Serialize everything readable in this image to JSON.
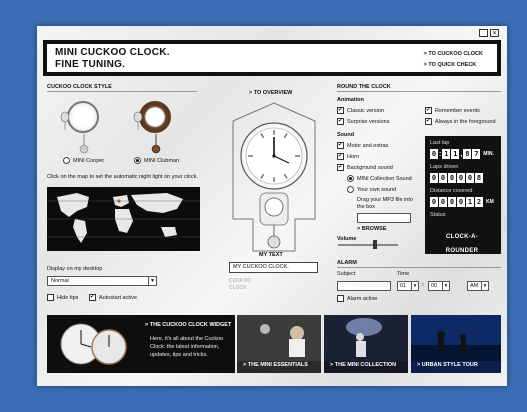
{
  "window": {
    "minimize_icon": "minimize-icon",
    "close_icon": "close-icon",
    "minimize_glyph": "_",
    "close_glyph": "×"
  },
  "banner": {
    "title_line1": "MINI CUCKOO CLOCK.",
    "title_line2": "FINE TUNING.",
    "link_clock": "> TO CUCKOO CLOCK",
    "link_quick_check": "> TO QUICK CHECK"
  },
  "style": {
    "heading": "CUCKOO CLOCK STYLE",
    "options": [
      {
        "label": "MINI Cooper",
        "selected": false
      },
      {
        "label": "MINI Clubman",
        "selected": true
      }
    ],
    "map_hint": "Click on the map to set the automatic night light on your clock.",
    "display_label": "Display on my desktop",
    "display_value": "Normal",
    "hide_tips": {
      "label": "Hide tips",
      "checked": false
    },
    "autostart": {
      "label": "Autostart active",
      "checked": true
    }
  },
  "overview": {
    "link": "> TO OVERVIEW",
    "mytext_label": "MY TEXT",
    "mytext_value": "MY CUCKOO CLOCK.",
    "mytext_preview": [
      "CUCKOO",
      "CLOCK"
    ]
  },
  "round": {
    "heading": "ROUND THE CLOCK",
    "animation_heading": "Animation",
    "animation": [
      {
        "label": "Classic version",
        "checked": true
      },
      {
        "label": "Surprise versions",
        "checked": true
      }
    ],
    "extra": [
      {
        "label": "Remember events",
        "checked": true
      },
      {
        "label": "Always in the foreground",
        "checked": true
      }
    ],
    "sound_heading": "Sound",
    "sound": [
      {
        "label": "Motor and extras",
        "checked": true
      },
      {
        "label": "Horn",
        "checked": true
      },
      {
        "label": "Background sound",
        "checked": true
      }
    ],
    "sound_choice": [
      {
        "label": "MINI Collection Sound",
        "selected": true
      },
      {
        "label": "Your own sound",
        "selected": false
      }
    ],
    "drag_hint": "Drag your MP3 file into the box",
    "browse": "> BROWSE",
    "volume_heading": "Volume",
    "volume_level": 0.58
  },
  "stats": {
    "last_lap": "Last lap",
    "last_lap_digits": [
      "0",
      "1",
      "1",
      "8",
      "7"
    ],
    "last_lap_unit": "MIN.",
    "laps_driven": "Laps driven",
    "laps_digits": [
      "0",
      "0",
      "0",
      "0",
      "0",
      "8"
    ],
    "distance": "Distance covered",
    "distance_digits": [
      "0",
      "0",
      "0",
      "0",
      "1",
      "2"
    ],
    "distance_unit": "KM",
    "status": "Status",
    "status_value": "CLOCK-A-ROUNDER"
  },
  "alarm": {
    "heading": "ALARM",
    "subject_label": "Subject",
    "subject_value": "",
    "time_label": "Time",
    "hour": "01",
    "minute": "00",
    "ampm": "AM",
    "active": {
      "label": "Alarm active",
      "checked": false
    }
  },
  "tiles": [
    {
      "label": "> THE CUCKOO CLOCK WIDGET",
      "desc": "Here, it's all about the Cuckoo Clock: the latest information, updates, tips and tricks."
    },
    {
      "label": "> THE MINI ESSENTIALS"
    },
    {
      "label": "> THE MINI COLLECTION"
    },
    {
      "label": "> URBAN STYLE TOUR"
    }
  ]
}
